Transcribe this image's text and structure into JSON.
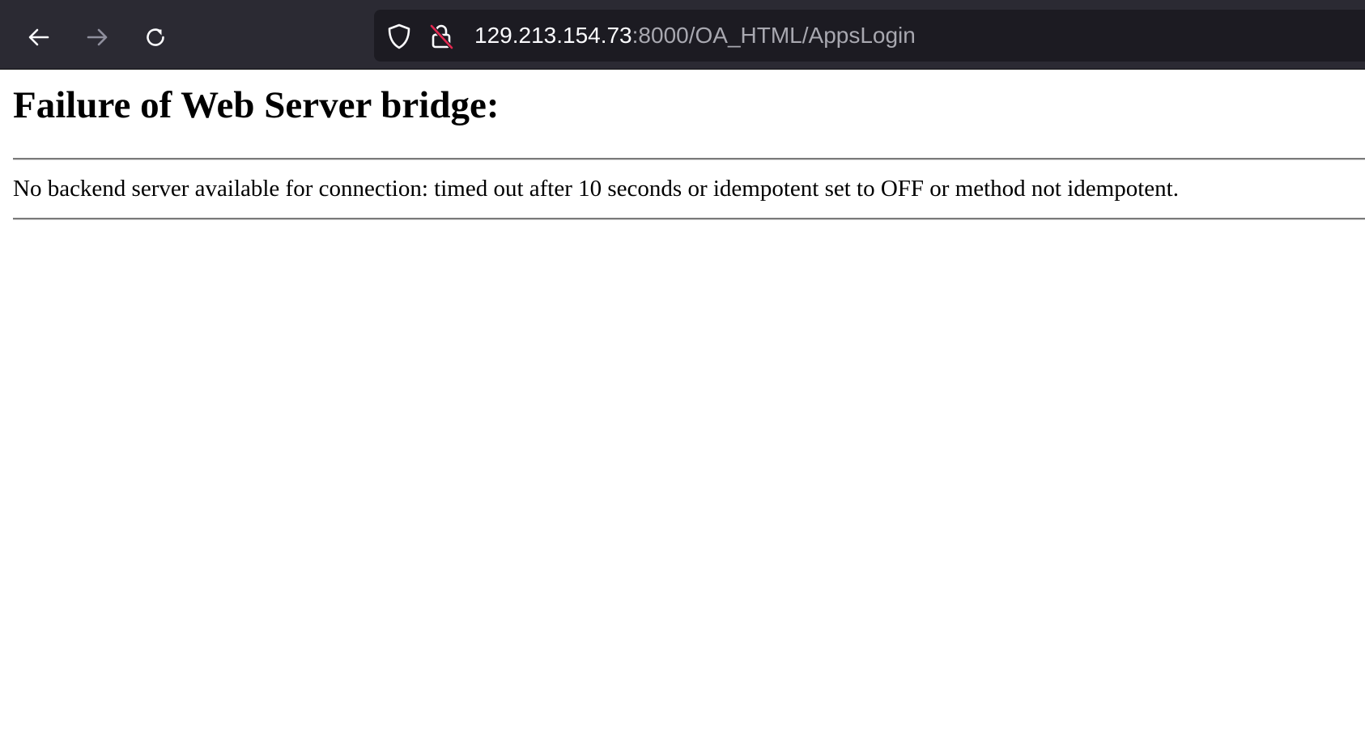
{
  "browser": {
    "url_host": "129.213.154.73",
    "url_rest": ":8000/OA_HTML/AppsLogin",
    "icons": {
      "back": "back-arrow-icon",
      "forward": "forward-arrow-icon",
      "reload": "reload-icon",
      "shield": "shield-icon",
      "insecure_lock": "insecure-lock-icon"
    },
    "colors": {
      "toolbar_bg": "#2b2a33",
      "urlbar_bg": "#1c1b22",
      "url_host": "#fbfbfe",
      "url_path": "#a8a8b0",
      "insecure_slash": "#e22850"
    }
  },
  "page": {
    "heading": "Failure of Web Server bridge:",
    "message": "No backend server available for connection: timed out after 10 seconds or idempotent set to OFF or method not idempotent."
  }
}
